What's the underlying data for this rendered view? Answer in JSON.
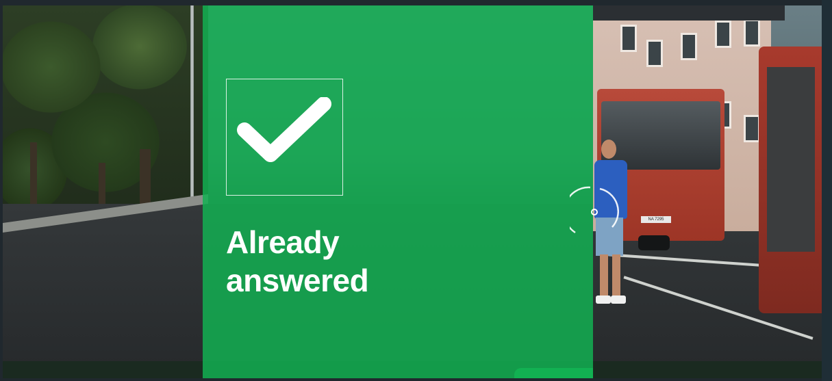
{
  "overlay": {
    "status_line1": "Already",
    "status_line2": "answered",
    "icon": "checkmark-icon",
    "color": "#12b252"
  },
  "scene": {
    "bus_plate": "NA 7295"
  },
  "reticle": {
    "icon": "focus-reticle-icon"
  }
}
